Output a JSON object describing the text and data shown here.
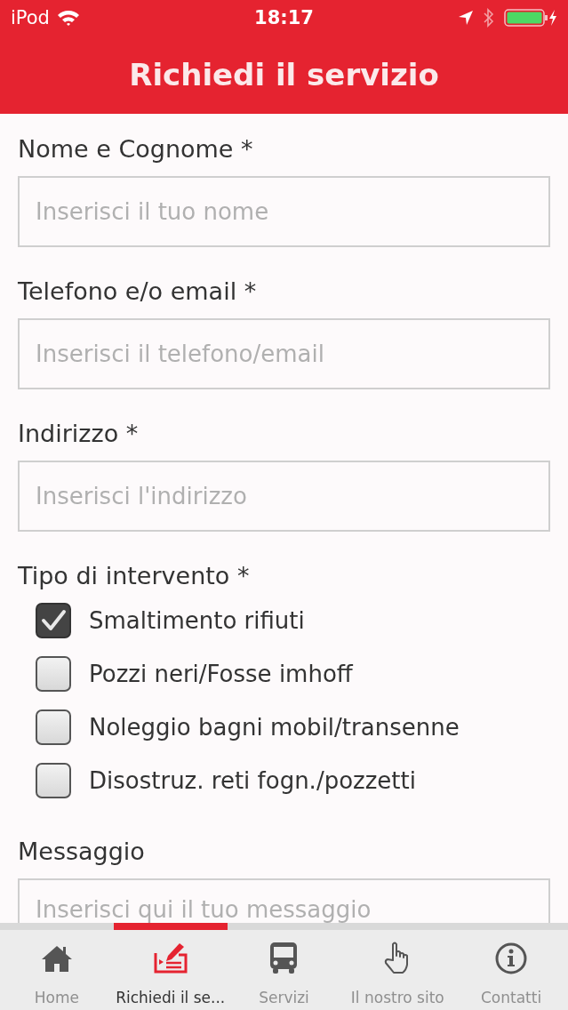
{
  "status_bar": {
    "carrier": "iPod",
    "time": "18:17"
  },
  "header": {
    "title": "Richiedi il servizio"
  },
  "form": {
    "fields": [
      {
        "label": "Nome e Cognome *",
        "placeholder": "Inserisci il tuo nome"
      },
      {
        "label": "Telefono e/o email *",
        "placeholder": "Inserisci il telefono/email"
      },
      {
        "label": "Indirizzo *",
        "placeholder": "Inserisci l'indirizzo"
      }
    ],
    "intervention": {
      "label": "Tipo di intervento *",
      "options": [
        {
          "label": "Smaltimento rifiuti",
          "checked": true
        },
        {
          "label": "Pozzi neri/Fosse imhoff",
          "checked": false
        },
        {
          "label": "Noleggio bagni mobil/transenne",
          "checked": false
        },
        {
          "label": "Disostruz. reti fogn./pozzetti",
          "checked": false
        }
      ]
    },
    "message": {
      "label": "Messaggio",
      "placeholder": "Inserisci qui il tuo messaggio"
    }
  },
  "tab_bar": [
    {
      "label": "Home",
      "selected": false
    },
    {
      "label": "Richiedi il se...",
      "selected": true
    },
    {
      "label": "Servizi",
      "selected": false
    },
    {
      "label": "Il nostro sito",
      "selected": false
    },
    {
      "label": "Contatti",
      "selected": false
    }
  ]
}
